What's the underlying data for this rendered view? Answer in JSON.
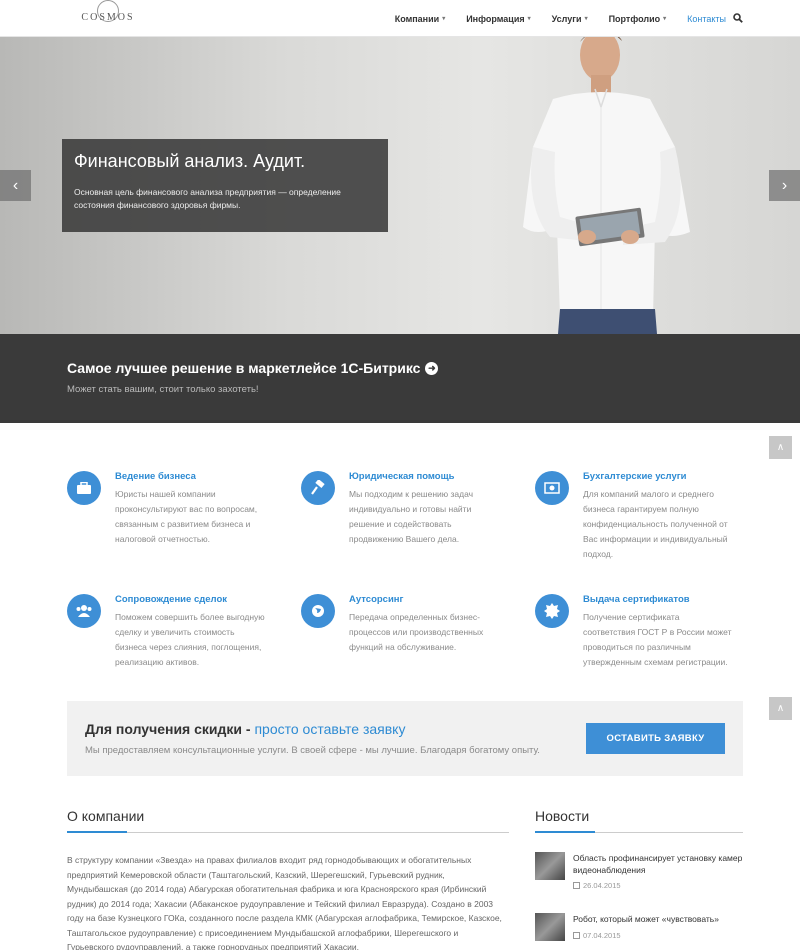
{
  "header": {
    "logo": "COSMOS",
    "nav": [
      {
        "label": "Компании",
        "dropdown": true
      },
      {
        "label": "Информация",
        "dropdown": true
      },
      {
        "label": "Услуги",
        "dropdown": true
      },
      {
        "label": "Портфолио",
        "dropdown": true
      },
      {
        "label": "Контакты",
        "dropdown": false,
        "active": true
      }
    ]
  },
  "hero": {
    "title": "Финансовый анализ. Аудит.",
    "text": "Основная цель финансового анализа предприятия — определение состояния финансового здоровья фирмы.",
    "prev": "‹",
    "next": "›"
  },
  "banner": {
    "title": "Самое лучшее решение в маркетлейсе 1С-Битрикс",
    "subtitle": "Может стать вашим, стоит только захотеть!"
  },
  "services": [
    {
      "title": "Ведение бизнеса",
      "text": "Юристы нашей компании проконсультируют вас по вопросам, связанным с развитием бизнеса и налоговой отчетностью.",
      "icon": "briefcase-icon"
    },
    {
      "title": "Юридическая помощь",
      "text": "Мы подходим к решению задач индивидуально и готовы найти решение и содействовать продвижению Вашего дела.",
      "icon": "gavel-icon"
    },
    {
      "title": "Бухгалтерские услуги",
      "text": "Для компаний малого и среднего бизнеса гарантируем полную конфиденциальность полученной от Вас информации и индивидуальный подход.",
      "icon": "money-icon"
    },
    {
      "title": "Сопровождение сделок",
      "text": "Поможем совершить более выгодную сделку и увеличить стоимость бизнеса через слияния, поглощения, реализацию активов.",
      "icon": "users-icon"
    },
    {
      "title": "Аутсорсинг",
      "text": "Передача определенных бизнес-процессов или производственных функций на обслуживание.",
      "icon": "globe-icon"
    },
    {
      "title": "Выдача сертификатов",
      "text": "Получение сертификата соответствия ГОСТ Р в России может проводиться по различным утвержденным схемам регистрации.",
      "icon": "certificate-icon"
    }
  ],
  "cta": {
    "title": "Для получения скидки - ",
    "highlight": "просто оставьте заявку",
    "subtitle": "Мы предоставляем консультационные услуги. В своей сфере - мы лучшие. Благодаря богатому опыту.",
    "button": "ОСТАВИТЬ ЗАЯВКУ"
  },
  "about": {
    "title": "О компании",
    "text": "В структуру компании «Звезда» на правах филиалов входит ряд горнодобывающих и обогатительных предприятий Кемеровской области (Таштагольский, Казский, Шерегешский, Гурьевский рудник, Мундыбашская (до 2014 года) Абагурская обогатительная фабрика и юга Красноярского края (Ирбинский рудник) до 2014 года; Хакасии (Абаканское рудоуправление и Тейский филиал Евразруда). Создано в 2003 году на базе Кузнецкого ГОКа, созданного после раздела КМК (Абагурская аглофабрика, Темирское, Казское, Таштагольское рудоуправление) с присоединением Мундыбашской аглофабрики, Шерегешского и Гурьевского рудоуправлений, а также горнорудных предприятий Хакасии."
  },
  "news": {
    "title": "Новости",
    "items": [
      {
        "title": "Область профинансирует установку камер видеонаблюдения",
        "date": "26.04.2015"
      },
      {
        "title": "Робот, который может «чувствовать»",
        "date": "07.04.2015"
      }
    ]
  },
  "scroll_top": "∧"
}
